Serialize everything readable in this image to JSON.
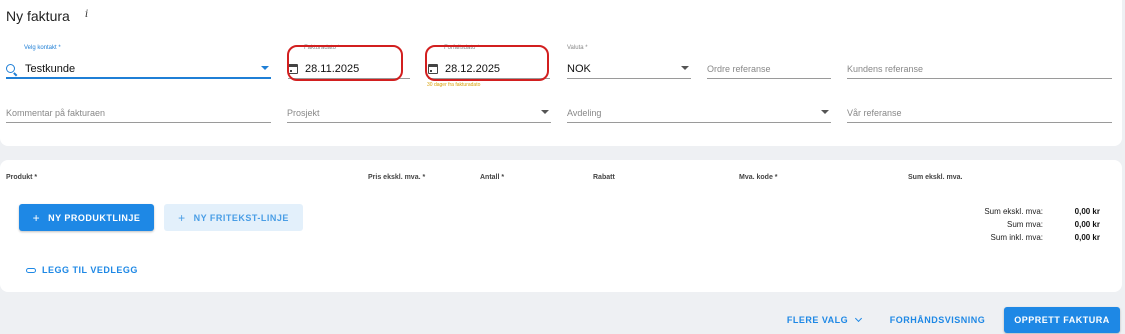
{
  "page": {
    "title": "Ny faktura",
    "info_icon": "i"
  },
  "form": {
    "contact": {
      "label": "Velg kontakt *",
      "value": "Testkunde"
    },
    "invoice_date": {
      "label": "Fakturadato *",
      "value": "28.11.2025"
    },
    "due_date": {
      "label": "Forfallsdato *",
      "value": "28.12.2025",
      "hint": "30 dager fra fakturadato"
    },
    "currency": {
      "label": "Valuta *",
      "value": "NOK"
    },
    "order_ref": {
      "placeholder": "Ordre referanse"
    },
    "customer_ref": {
      "placeholder": "Kundens referanse"
    },
    "comment": {
      "placeholder": "Kommentar på fakturaen"
    },
    "project": {
      "placeholder": "Prosjekt"
    },
    "department": {
      "placeholder": "Avdeling"
    },
    "our_ref": {
      "placeholder": "Vår referanse"
    }
  },
  "lines": {
    "headers": {
      "product": "Produkt *",
      "price": "Pris ekskl. mva. *",
      "quantity": "Antall *",
      "discount": "Rabatt",
      "vat_code": "Mva. kode *",
      "sum": "Sum ekskl. mva."
    },
    "add_product_line": "NY PRODUKTLINJE",
    "add_freetext_line": "NY FRITEKST-LINJE",
    "add_attachment": "LEGG TIL VEDLEGG",
    "plus_symbol": "+"
  },
  "totals": {
    "excl_label": "Sum ekskl. mva:",
    "excl_value": "0,00 kr",
    "vat_label": "Sum mva:",
    "vat_value": "0,00 kr",
    "incl_label": "Sum inkl. mva:",
    "incl_value": "0,00 kr"
  },
  "footer": {
    "more_options": "FLERE VALG",
    "preview": "FORHÅNDSVISNING",
    "create": "OPPRETT FAKTURA"
  },
  "colors": {
    "accent": "#1e88e5",
    "highlight_oval": "#d21f1f",
    "hint": "#d9a20b"
  },
  "icons": [
    "search-icon",
    "calendar-icon",
    "dropdown-caret-icon",
    "plus-icon",
    "paperclip-icon",
    "chevron-down-icon",
    "info-icon"
  ]
}
